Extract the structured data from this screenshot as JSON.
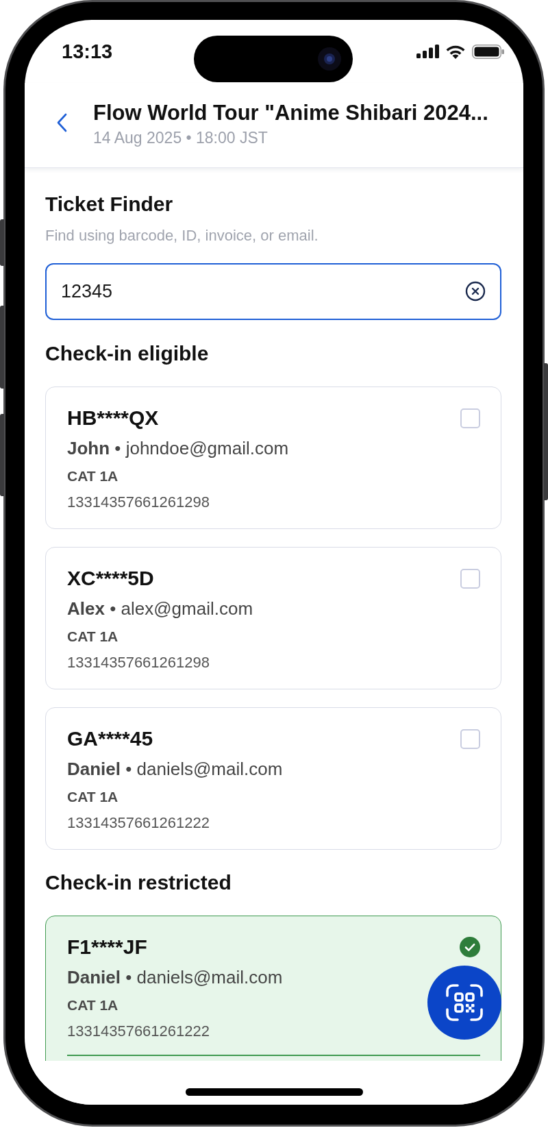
{
  "status_bar": {
    "time": "13:13"
  },
  "header": {
    "title": "Flow World Tour \"Anime Shibari 2024...",
    "subtitle": "14 Aug 2025 • 18:00 JST"
  },
  "ticket_finder": {
    "title": "Ticket Finder",
    "hint": "Find using barcode, ID, invoice, or email.",
    "search": {
      "value": "12345"
    }
  },
  "sections": [
    {
      "title": "Check-in eligible",
      "tickets": [
        {
          "code": "HB****QX",
          "holder": "**John** • johndoe@gmail.com",
          "category": "CAT 1A",
          "number": "13314357661261298",
          "selected": false
        },
        {
          "code": "XC****5D",
          "holder": "**Alex** • alex@gmail.com",
          "category": "CAT 1A",
          "number": "13314357661261298",
          "selected": false
        },
        {
          "code": "GA****45",
          "holder": "**Daniel** • daniels@mail.com",
          "category": "CAT 1A",
          "number": "13314357661261222",
          "selected": false
        }
      ]
    },
    {
      "title": "Check-in restricted",
      "tickets": [
        {
          "code": "F1****JF",
          "holder": "**Daniel** • daniels@mail.com",
          "category": "CAT 1A",
          "number": "13314357661261222",
          "selected": true
        }
      ]
    }
  ]
}
